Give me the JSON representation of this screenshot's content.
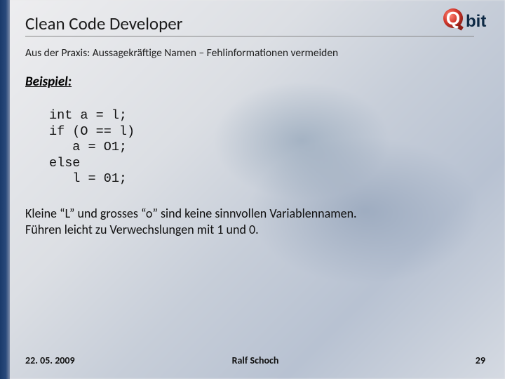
{
  "header": {
    "title": "Clean Code Developer",
    "logo_text_main": "Q",
    "logo_text_sub": "bit"
  },
  "subtitle": "Aus der Praxis: Aussagekräftige Namen – Fehlinformationen vermeiden",
  "example_label": "Beispiel:",
  "code": "int a = l;\nif (O == l)\n   a = O1;\nelse\n   l = 01;",
  "note_line1": "Kleine “L” und grosses “o” sind keine sinnvollen Variablennamen.",
  "note_line2": "Führen leicht zu Verwechslungen mit 1 und 0.",
  "footer": {
    "date": "22. 05. 2009",
    "author": "Ralf Schoch",
    "page": "29"
  },
  "colors": {
    "sidebar_base": "#1a3a6b",
    "logo_accent": "#d43a2f",
    "logo_dark": "#0e2a45"
  }
}
